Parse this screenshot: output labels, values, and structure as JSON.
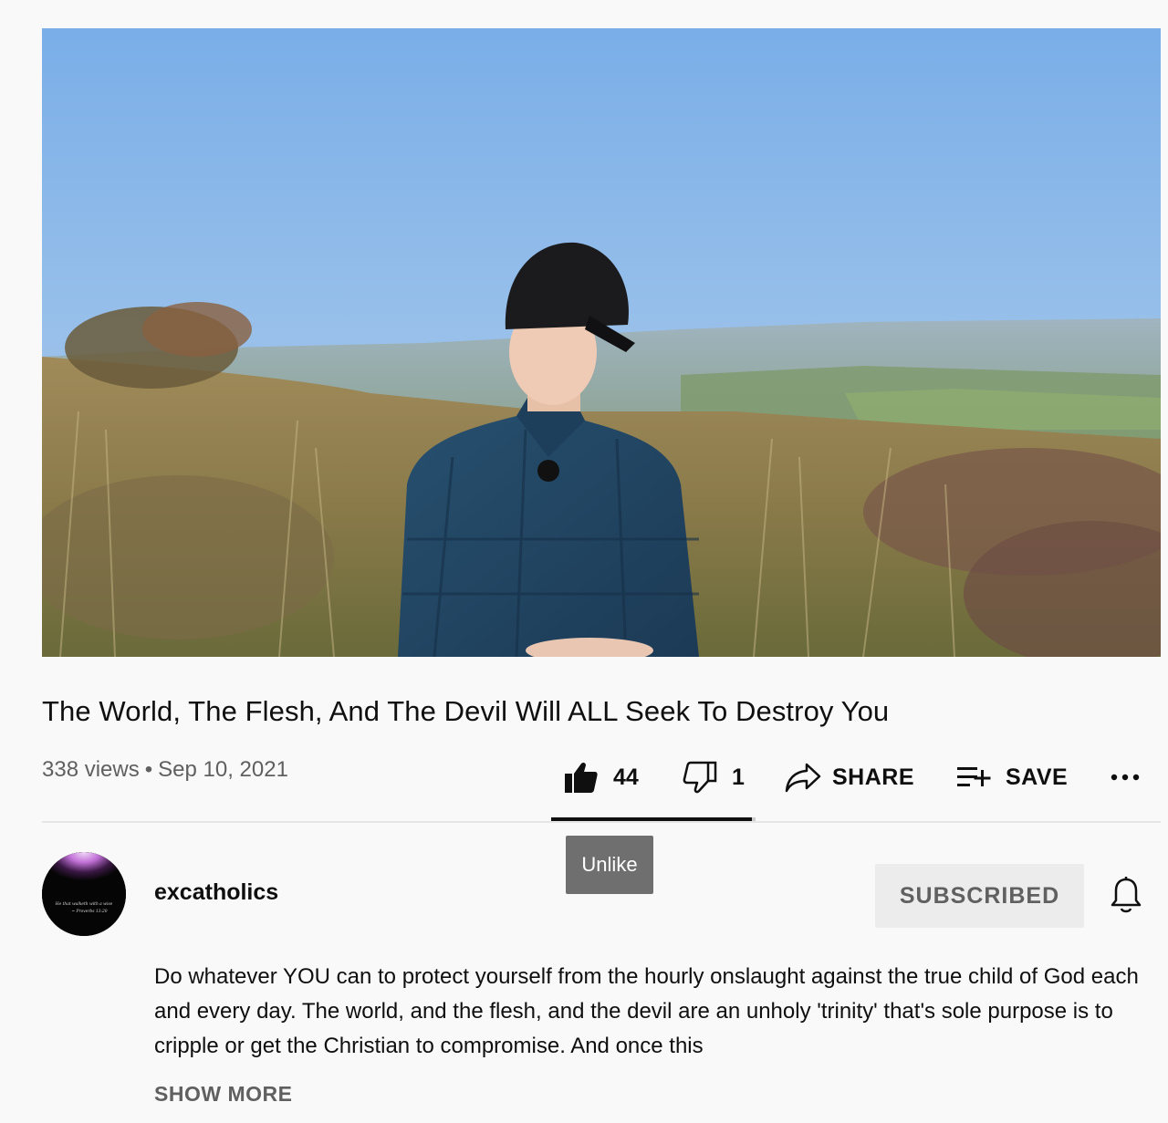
{
  "video": {
    "title": "The World, The Flesh, And The Devil Will ALL Seek To Destroy You",
    "views": "338 views",
    "separator": "•",
    "date": "Sep 10, 2021"
  },
  "actions": {
    "like_count": "44",
    "dislike_count": "1",
    "share_label": "SHARE",
    "save_label": "SAVE",
    "more_icon": "more-horizontal-icon",
    "like_ratio": 0.98
  },
  "tooltip": {
    "text": "Unlike"
  },
  "channel": {
    "name": "excatholics",
    "subscribe_label": "SUBSCRIBED",
    "avatar_caption_line1": "He that walketh with a wise",
    "avatar_caption_line2": "~ Proverbs 13:20"
  },
  "description": {
    "text": "Do whatever YOU can to protect yourself from the hourly onslaught against the true child of God each and every day. The world, and the flesh, and the devil are an unholy 'trinity' that's sole purpose is to cripple or get the Christian to compromise. And once this",
    "show_more_label": "SHOW MORE"
  },
  "colors": {
    "background": "#f9f9f9",
    "text_primary": "#0f0f0f",
    "text_secondary": "#606060",
    "subscribed_bg": "#ececec",
    "tooltip_bg": "#6f6f6f",
    "divider": "#e5e5e5"
  }
}
